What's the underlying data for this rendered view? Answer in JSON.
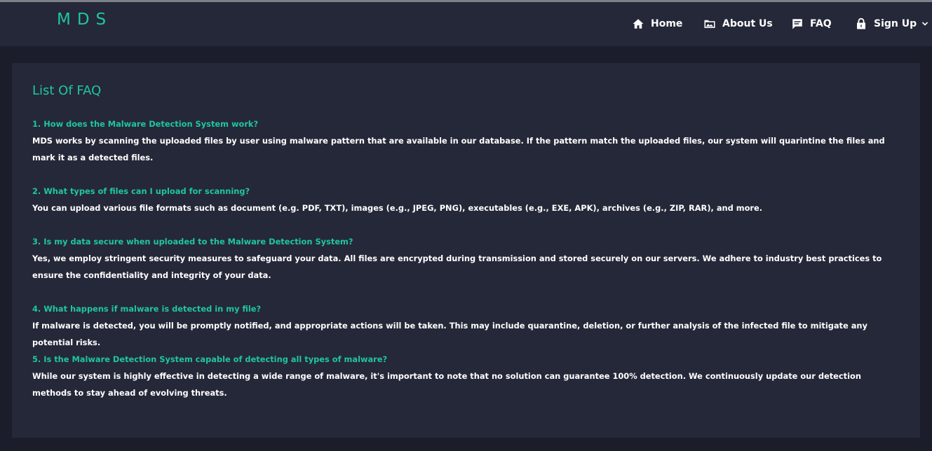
{
  "header": {
    "logo": "MDS",
    "nav": {
      "home": {
        "label": "Home",
        "icon": "home-icon"
      },
      "about": {
        "label": "About Us",
        "icon": "image-icon"
      },
      "faq": {
        "label": "FAQ",
        "icon": "message-icon"
      },
      "signup": {
        "label": "Sign Up",
        "icon": "lock-icon",
        "dropdown_icon": "chevron-down-icon"
      }
    }
  },
  "main": {
    "title": "List Of FAQ",
    "faqs": [
      {
        "question": "1. How does the Malware Detection System work?",
        "answer": "MDS works by scanning the uploaded files by user using malware pattern that are available in our database. If the pattern match the uploaded files, our system will quarintine the files and mark it as a detected files."
      },
      {
        "question": "2. What types of files can I upload for scanning?",
        "answer": "You can upload various file formats such as document (e.g. PDF, TXT), images (e.g., JPEG, PNG), executables (e.g., EXE, APK), archives (e.g., ZIP, RAR), and more."
      },
      {
        "question": "3. Is my data secure when uploaded to the Malware Detection System?",
        "answer": "Yes, we employ stringent security measures to safeguard your data. All files are encrypted during transmission and stored securely on our servers. We adhere to industry best practices to ensure the confidentiality and integrity of your data."
      },
      {
        "question": "4. What happens if malware is detected in my file?",
        "answer": "If malware is detected, you will be promptly notified, and appropriate actions will be taken. This may include quarantine, deletion, or further analysis of the infected file to mitigate any potential risks."
      },
      {
        "question": "5. Is the Malware Detection System capable of detecting all types of malware?",
        "answer": "While our system is highly effective in detecting a wide range of malware, it's important to note that no solution can guarantee 100% detection. We continuously update our detection methods to stay ahead of evolving threats."
      }
    ]
  },
  "colors": {
    "accent": "#1fc6a0",
    "background": "#1b1d2b",
    "panel": "#252838",
    "text": "#ffffff"
  }
}
